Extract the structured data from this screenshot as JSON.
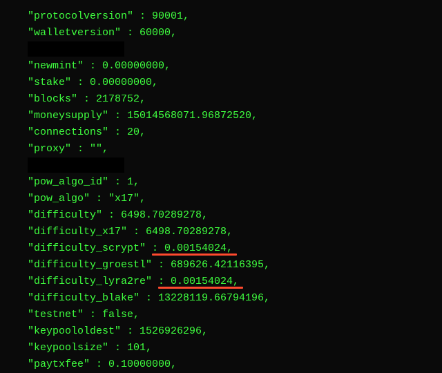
{
  "rows": [
    {
      "key": "protocolversion",
      "value": "90001"
    },
    {
      "key": "walletversion",
      "value": "60000"
    },
    {
      "key": "redacted",
      "value": ""
    },
    {
      "key": "newmint",
      "value": "0.00000000"
    },
    {
      "key": "stake",
      "value": "0.00000000"
    },
    {
      "key": "blocks",
      "value": "2178752"
    },
    {
      "key": "moneysupply",
      "value": "15014568071.96872520"
    },
    {
      "key": "connections",
      "value": "20"
    },
    {
      "key": "proxy",
      "value": "\"\""
    },
    {
      "key": "redacted",
      "value": ""
    },
    {
      "key": "pow_algo_id",
      "value": "1"
    },
    {
      "key": "pow_algo",
      "value": "\"x17\""
    },
    {
      "key": "difficulty",
      "value": "6498.70289278"
    },
    {
      "key": "difficulty_x17",
      "value": "6498.70289278"
    },
    {
      "key": "difficulty_scrypt",
      "value": "0.00154024",
      "underline": true
    },
    {
      "key": "difficulty_groestl",
      "value": "689626.42116395"
    },
    {
      "key": "difficulty_lyra2re",
      "value": "0.00154024",
      "underline": true
    },
    {
      "key": "difficulty_blake",
      "value": "13228119.66794196"
    },
    {
      "key": "testnet",
      "value": "false"
    },
    {
      "key": "keypoololdest",
      "value": "1526926296"
    },
    {
      "key": "keypoolsize",
      "value": "101"
    },
    {
      "key": "paytxfee",
      "value": "0.10000000"
    }
  ]
}
